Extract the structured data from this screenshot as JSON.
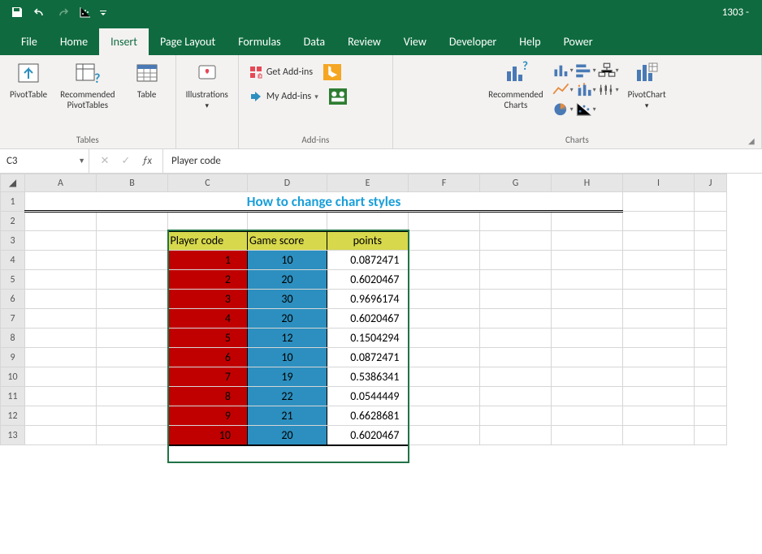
{
  "titlebar": {
    "doc": "1303 -"
  },
  "tabs": [
    "File",
    "Home",
    "Insert",
    "Page Layout",
    "Formulas",
    "Data",
    "Review",
    "View",
    "Developer",
    "Help",
    "Power"
  ],
  "active_tab": "Insert",
  "ribbon": {
    "tables": {
      "label": "Tables",
      "pivottable": "PivotTable",
      "recommended": "Recommended\nPivotTables",
      "table": "Table"
    },
    "illustrations": {
      "btn": "Illustrations"
    },
    "addins": {
      "label": "Add-ins",
      "get": "Get Add-ins",
      "my": "My Add-ins"
    },
    "charts": {
      "label": "Charts",
      "recommended": "Recommended\nCharts",
      "pivotchart": "PivotChart"
    }
  },
  "formula_bar": {
    "cell": "C3",
    "value": "Player code"
  },
  "columns": [
    "A",
    "B",
    "C",
    "D",
    "E",
    "F",
    "G",
    "H",
    "I",
    "J"
  ],
  "rows": [
    1,
    2,
    3,
    4,
    5,
    6,
    7,
    8,
    9,
    10,
    11,
    12,
    13
  ],
  "sheet_title": "How to change chart styles",
  "table": {
    "headers": [
      "Player code",
      "Game score",
      "points"
    ],
    "data": [
      [
        1,
        10,
        "0.0872471"
      ],
      [
        2,
        20,
        "0.6020467"
      ],
      [
        3,
        30,
        "0.9696174"
      ],
      [
        4,
        20,
        "0.6020467"
      ],
      [
        5,
        12,
        "0.1504294"
      ],
      [
        6,
        10,
        "0.0872471"
      ],
      [
        7,
        19,
        "0.5386341"
      ],
      [
        8,
        22,
        "0.0544449"
      ],
      [
        9,
        21,
        "0.6628681"
      ],
      [
        10,
        20,
        "0.6020467"
      ]
    ]
  }
}
